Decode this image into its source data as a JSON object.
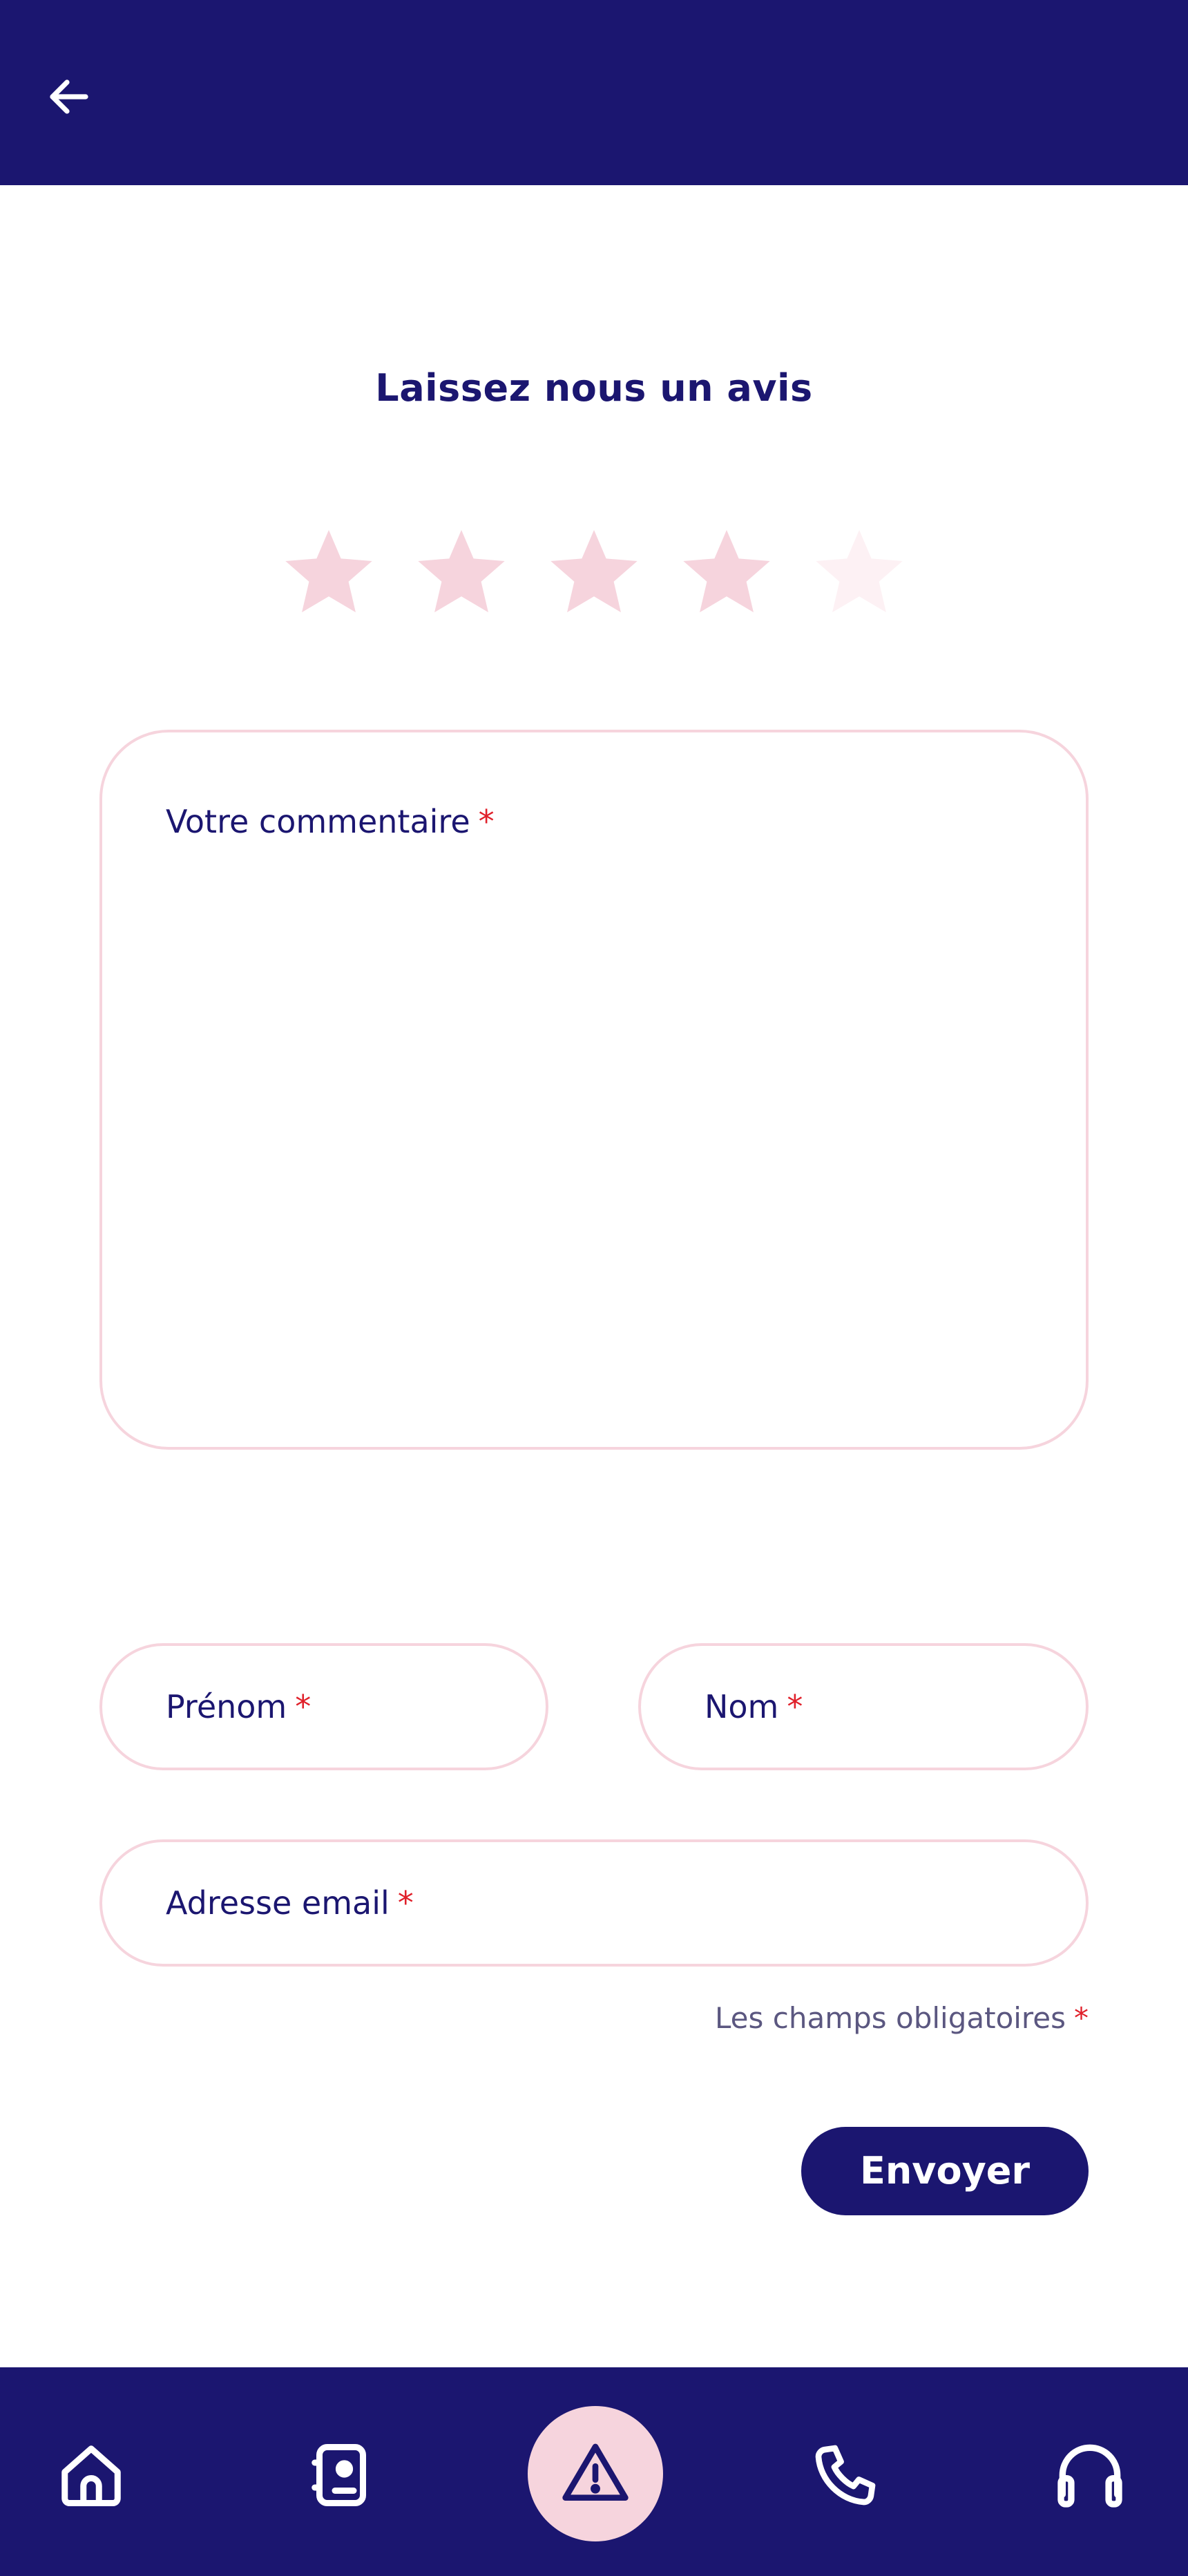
{
  "header": {
    "back_icon": "arrow-left-icon"
  },
  "title": "Laissez nous un avis",
  "rating": {
    "value": 4,
    "max": 5,
    "filled_color": "#f6d4dd",
    "empty_color": "#fdf1f4"
  },
  "form": {
    "comment_label": "Votre commentaire",
    "firstname_label": "Prénom",
    "lastname_label": "Nom",
    "email_label": "Adresse email",
    "required_mark": "*",
    "required_note": "Les champs obligatoires"
  },
  "submit_label": "Envoyer",
  "nav": {
    "items": [
      {
        "icon": "home-icon"
      },
      {
        "icon": "document-icon"
      },
      {
        "icon": "warning-icon",
        "active": true
      },
      {
        "icon": "phone-icon"
      },
      {
        "icon": "headset-icon"
      }
    ]
  },
  "colors": {
    "primary": "#1b1670",
    "accent_pink": "#f6d4dd",
    "required_red": "#e0202a"
  }
}
